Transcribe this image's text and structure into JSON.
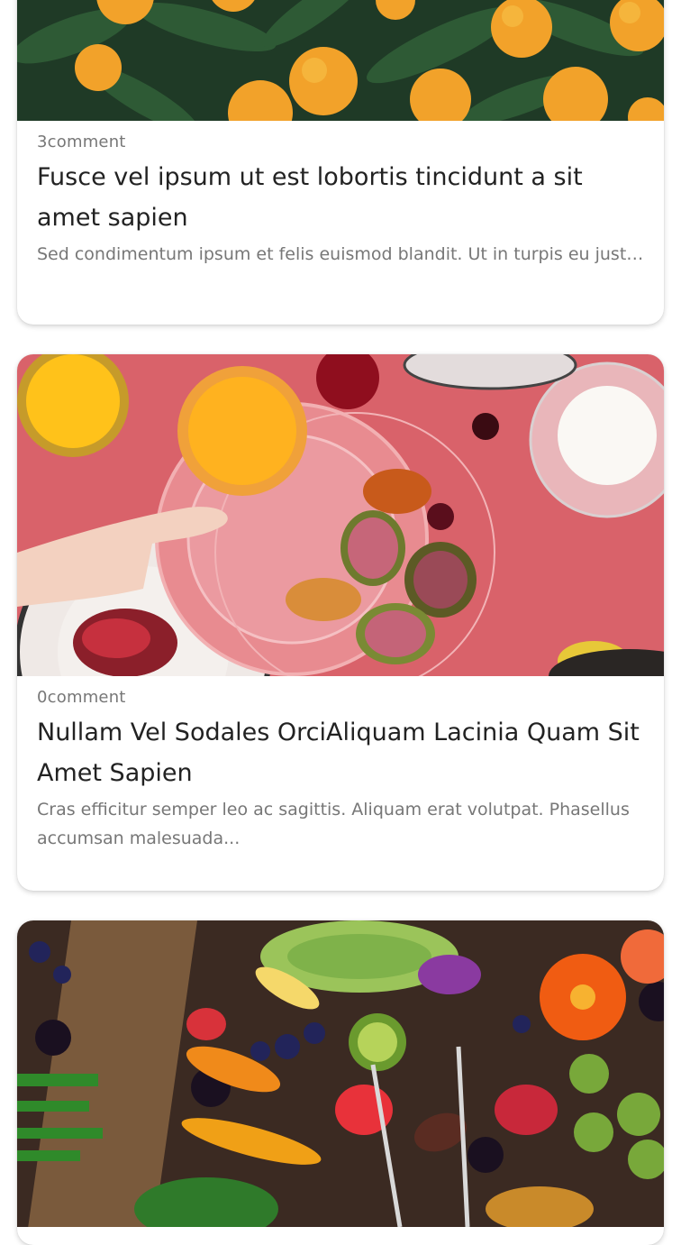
{
  "posts": [
    {
      "comments": "3comment",
      "title": "Fusce vel ipsum ut est lobortis tincidunt a sit amet sapien",
      "excerpt": "Sed condimentum ipsum et felis euismod blandit. Ut in turpis eu justo...",
      "image_icon": "oranges-photo"
    },
    {
      "comments": "0comment",
      "title": "Nullam Vel Sodales OrciAliquam Lacinia Quam Sit Amet Sapien",
      "excerpt": "Cras efficitur semper leo ac sagittis. Aliquam erat volutpat. Phasellus accumsan malesuada...",
      "image_icon": "breakfast-table-photo"
    },
    {
      "comments": "",
      "title": "",
      "excerpt": "",
      "image_icon": "fruit-platter-photo"
    }
  ],
  "colors": {
    "card_bg": "#ffffff",
    "title": "#222222",
    "meta": "#777777"
  }
}
